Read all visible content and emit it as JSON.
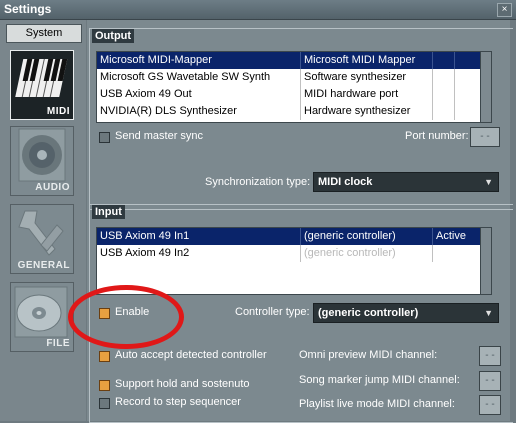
{
  "window": {
    "title": "Settings",
    "close": "×"
  },
  "sidebar": {
    "tab": "System",
    "items": [
      {
        "label": "MIDI",
        "icon": "midi-keyboard-icon"
      },
      {
        "label": "AUDIO",
        "icon": "speaker-icon"
      },
      {
        "label": "GENERAL",
        "icon": "wrench-icon"
      },
      {
        "label": "FILE",
        "icon": "disc-icon"
      }
    ]
  },
  "output": {
    "title": "Output",
    "rows": [
      {
        "name": "Microsoft MIDI-Mapper",
        "type": "Microsoft MIDI Mapper",
        "selected": true
      },
      {
        "name": "Microsoft GS Wavetable SW Synth",
        "type": "Software synthesizer"
      },
      {
        "name": "USB Axiom 49 Out",
        "type": "MIDI hardware port"
      },
      {
        "name": "NVIDIA(R) DLS Synthesizer",
        "type": "Hardware synthesizer"
      }
    ],
    "send_master_sync": "Send master sync",
    "port_number_label": "Port number:",
    "port_number_value": "- -",
    "sync_type_label": "Synchronization type:",
    "sync_type_value": "MIDI clock"
  },
  "input": {
    "title": "Input",
    "rows": [
      {
        "name": "USB Axiom 49 In1",
        "controller": "(generic controller)",
        "status": "Active",
        "selected": true
      },
      {
        "name": "USB Axiom 49 In2",
        "controller": "(generic controller)",
        "status": ""
      }
    ],
    "enable": "Enable",
    "controller_type_label": "Controller type:",
    "controller_type_value": "(generic controller)",
    "auto_accept": "Auto accept detected controller",
    "support_hold": "Support hold and sostenuto",
    "record_step": "Record to step sequencer",
    "omni_label": "Omni preview MIDI channel:",
    "song_marker_label": "Song marker jump MIDI channel:",
    "playlist_label": "Playlist live mode MIDI channel:",
    "channel_value": "- -"
  },
  "colors": {
    "selection": "#0a246a",
    "accent_checkbox": "#e8a040",
    "annotation": "#e01818"
  }
}
